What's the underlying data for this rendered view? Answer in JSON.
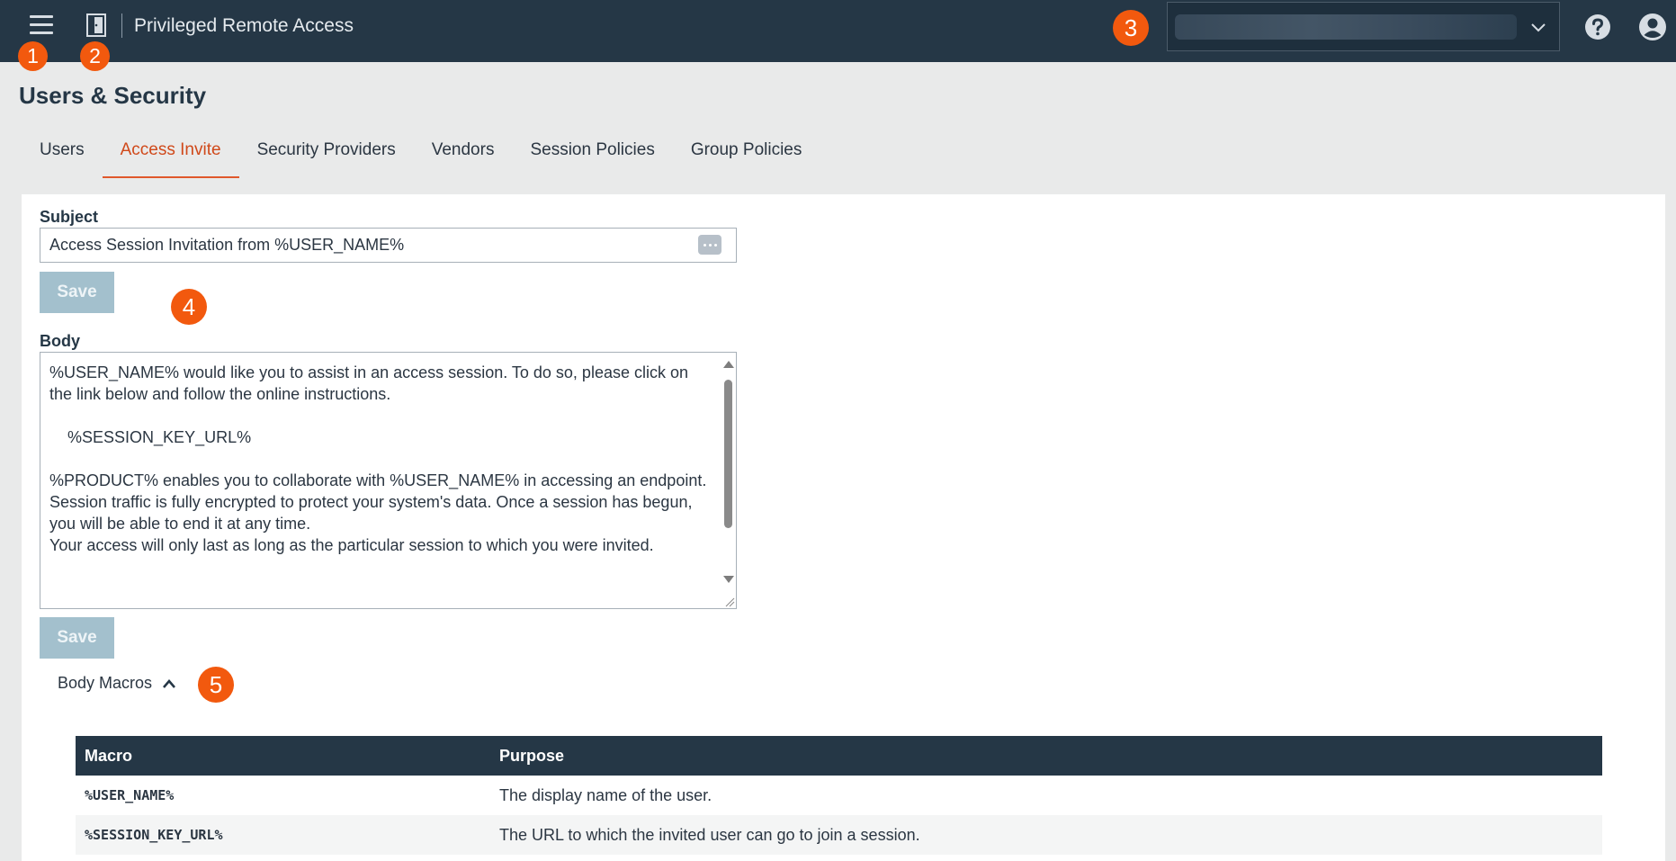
{
  "header": {
    "app_title": "Privileged Remote Access",
    "menu_icon": "hamburger-menu-icon",
    "logo_icon": "door-icon",
    "site_selector_value": "",
    "help_icon": "help-icon",
    "user_icon": "user-account-icon"
  },
  "callouts": [
    "1",
    "2",
    "3",
    "4",
    "5"
  ],
  "callout_color": "#f2590e",
  "page": {
    "title": "Users & Security",
    "tabs": [
      {
        "label": "Users",
        "active": false
      },
      {
        "label": "Access Invite",
        "active": true
      },
      {
        "label": "Security Providers",
        "active": false
      },
      {
        "label": "Vendors",
        "active": false
      },
      {
        "label": "Session Policies",
        "active": false
      },
      {
        "label": "Group Policies",
        "active": false
      }
    ]
  },
  "form": {
    "subject_label": "Subject",
    "subject_value": "Access Session Invitation from %USER_NAME%",
    "save_label": "Save",
    "body_label": "Body",
    "body_value": "%USER_NAME% would like you to assist in an access session. To do so, please click on the link below and follow the online instructions.\n\n    %SESSION_KEY_URL%\n\n%PRODUCT% enables you to collaborate with %USER_NAME% in accessing an endpoint. Session traffic is fully encrypted to protect your system's data. Once a session has begun, you will be able to end it at any time.\nYour access will only last as long as the particular session to which you were invited."
  },
  "macros": {
    "toggle_label": "Body Macros",
    "columns": [
      "Macro",
      "Purpose"
    ],
    "rows": [
      {
        "macro": "%USER_NAME%",
        "purpose": "The display name of the user."
      },
      {
        "macro": "%SESSION_KEY_URL%",
        "purpose": "The URL to which the invited user can go to join a session."
      }
    ]
  }
}
